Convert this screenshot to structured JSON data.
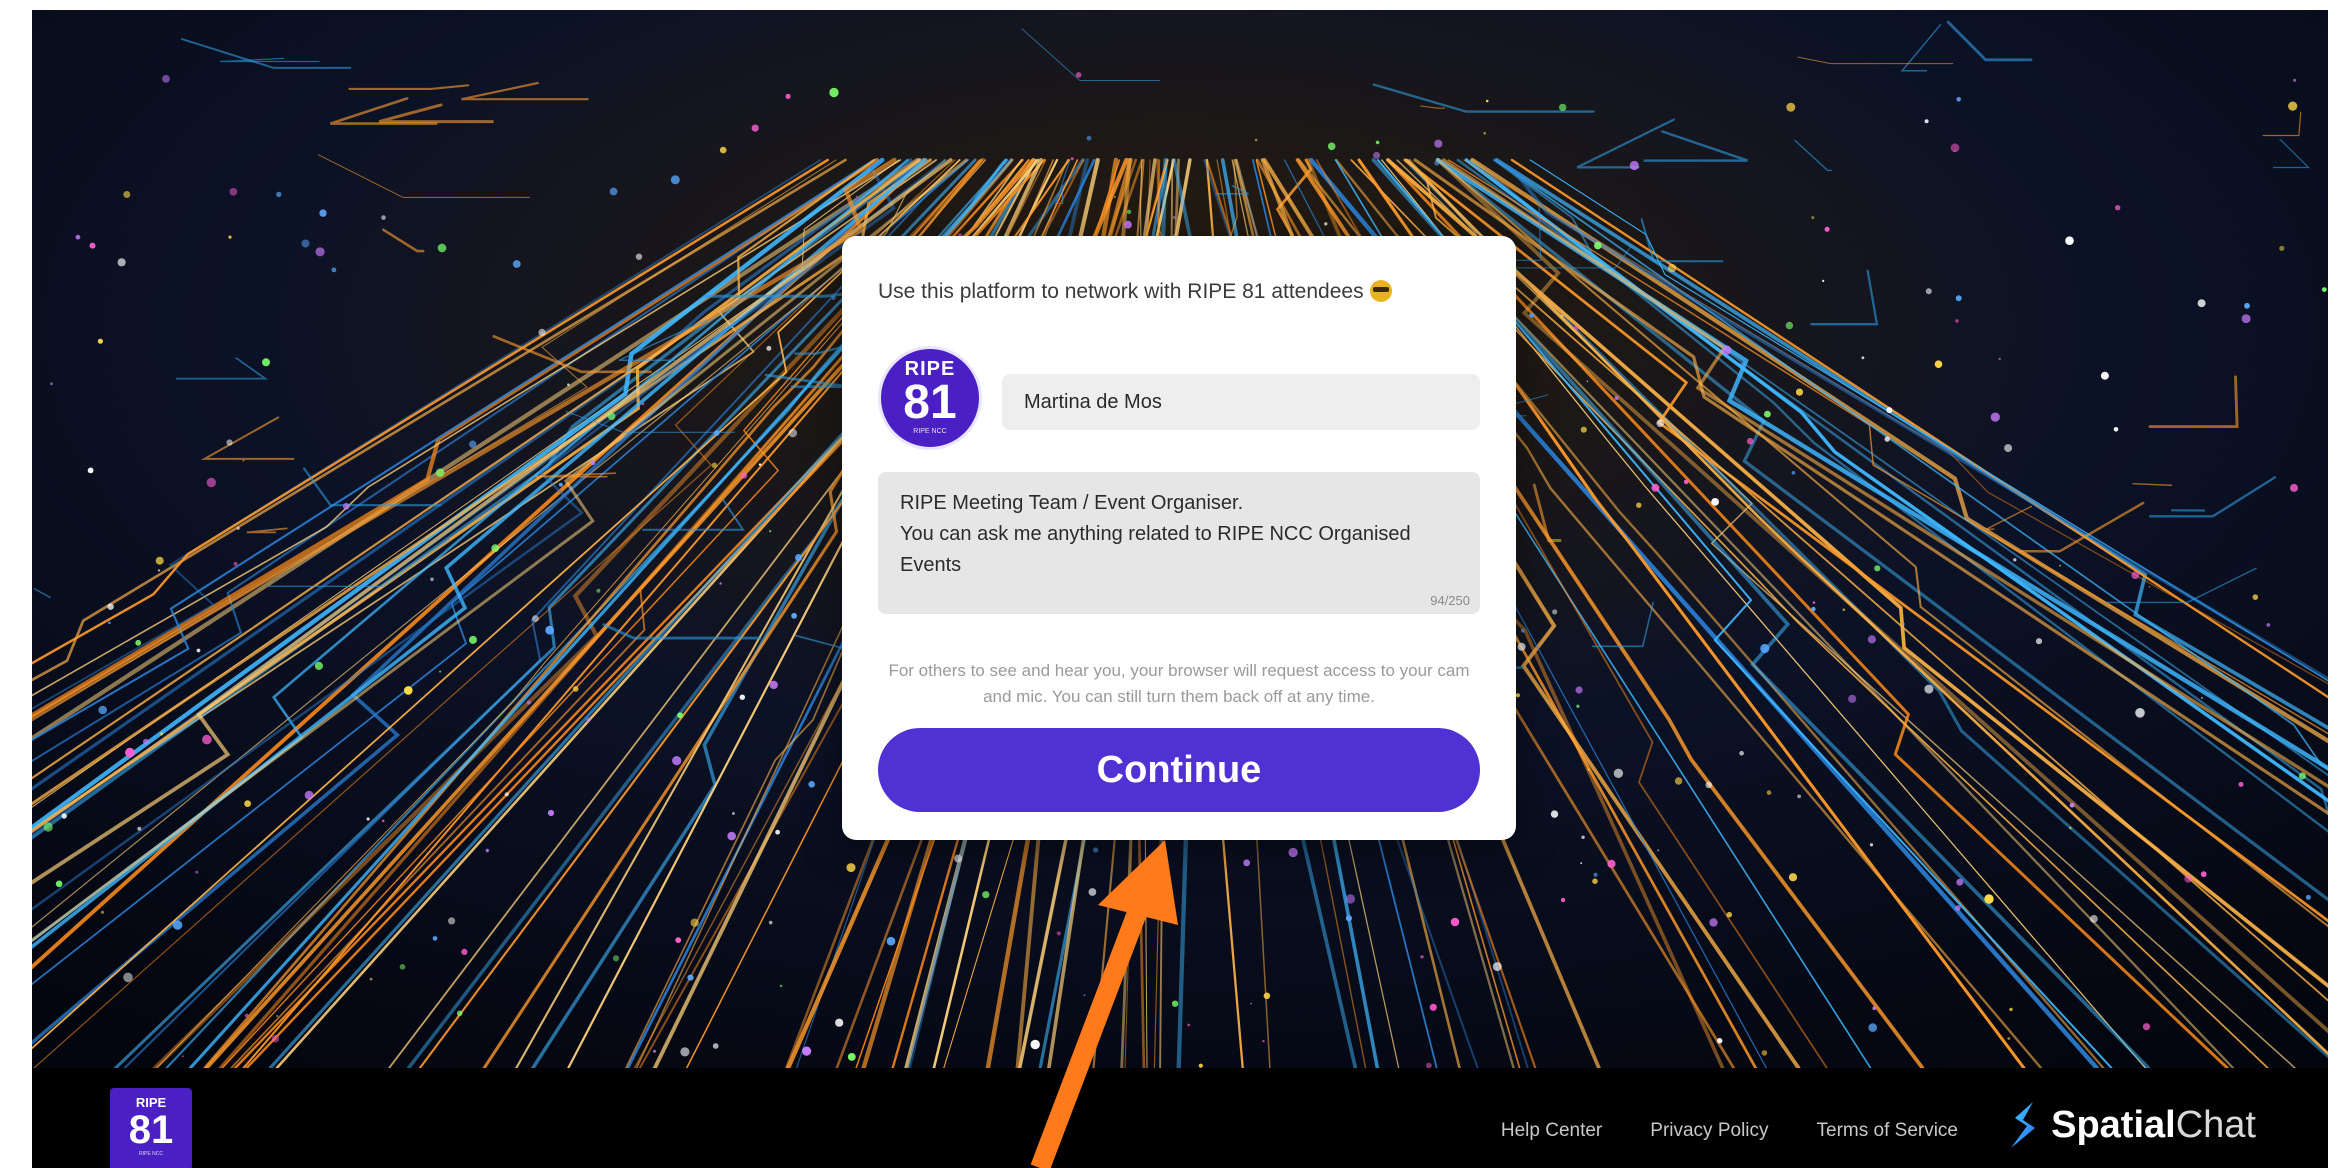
{
  "card": {
    "heading": "Use this platform to network with RIPE 81 attendees",
    "avatar": {
      "top": "RIPE",
      "number": "81",
      "sub": "RIPE NCC"
    },
    "name_value": "Martina de Mos",
    "bio_value": "RIPE Meeting Team / Event Organiser.\nYou can ask me anything related to RIPE NCC Organised Events",
    "bio_counter": "94/250",
    "permission_note": "For others to see and hear you, your browser will request access to your cam and mic. You can still turn them back off at any time.",
    "continue_label": "Continue"
  },
  "footer": {
    "logo": {
      "top": "RIPE",
      "number": "81",
      "sub": "RIPE NCC"
    },
    "links": [
      "Help Center",
      "Privacy Policy",
      "Terms of Service"
    ],
    "brand_bold": "Spatial",
    "brand_light": "Chat"
  },
  "colors": {
    "accent": "#5031d4",
    "ripe_purple": "#4a1fc4",
    "annotation_arrow": "#ff7a1a"
  },
  "icons": {
    "heading_emoji": "sunglasses-face-icon",
    "brand": "spatialchat-logo-icon"
  }
}
